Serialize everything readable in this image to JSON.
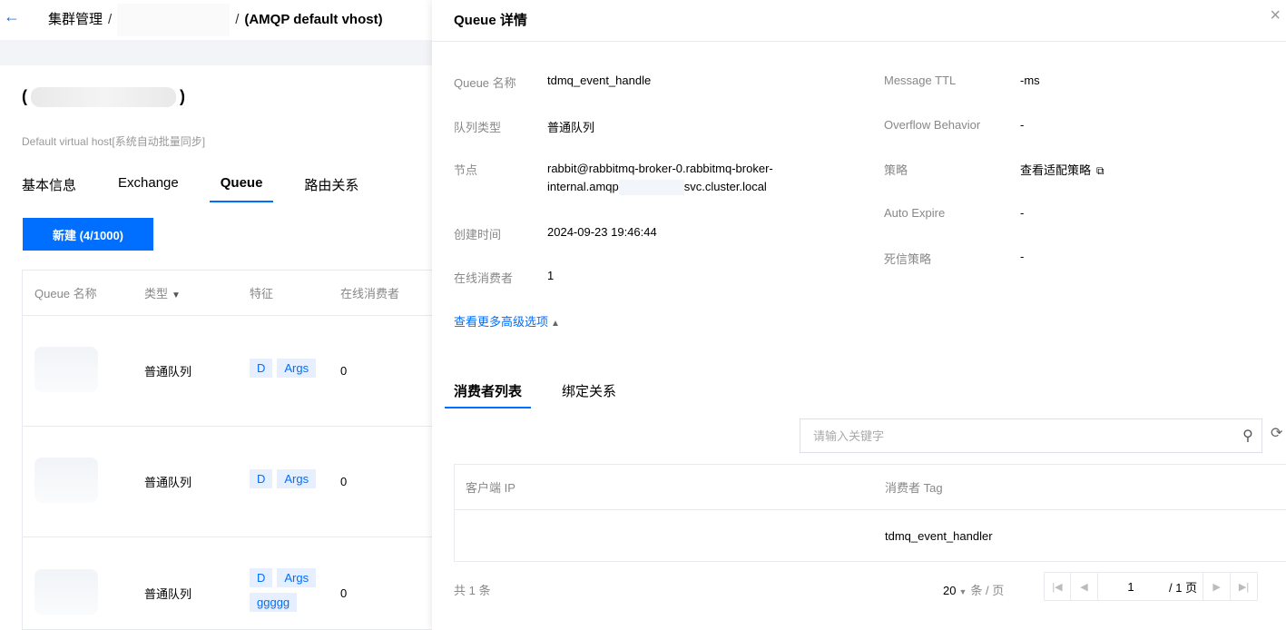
{
  "topbar": {
    "back_icon": "←",
    "crumb_1": "集群管理",
    "sep": "/",
    "crumb_3": "(AMQP default vhost)"
  },
  "left": {
    "cluster_suffix": ")",
    "cluster_prefix": "(",
    "vhost_desc": "Default virtual host[系统自动批量同步]",
    "tabs": [
      "基本信息",
      "Exchange",
      "Queue",
      "路由关系"
    ],
    "new_button": "新建 (4/1000)",
    "table": {
      "headers": [
        "Queue 名称",
        "类型",
        "特征",
        "在线消费者"
      ],
      "rows": [
        {
          "type": "普通队列",
          "tags": [
            "D",
            "Args"
          ],
          "consumers": "0"
        },
        {
          "type": "普通队列",
          "tags": [
            "D",
            "Args"
          ],
          "consumers": "0"
        },
        {
          "type": "普通队列",
          "tags": [
            "D",
            "Args",
            "ggggg"
          ],
          "consumers": "0"
        }
      ]
    }
  },
  "drawer": {
    "title": "Queue 详情",
    "close_icon": "×",
    "fields": {
      "queue_name_label": "Queue 名称",
      "queue_name": "tdmq_event_handle",
      "queue_type_label": "队列类型",
      "queue_type": "普通队列",
      "node_label": "节点",
      "node_line1": "rabbit@rabbitmq-broker-0.rabbitmq-broker-",
      "node_line2a": "internal.amqp",
      "node_line2b": "svc.cluster.local",
      "created_label": "创建时间",
      "created": "2024-09-23 19:46:44",
      "consumers_label": "在线消费者",
      "consumers": "1",
      "ttl_label": "Message TTL",
      "ttl": "-ms",
      "overflow_label": "Overflow Behavior",
      "overflow": "-",
      "policy_label": "策略",
      "policy_link": "查看适配策略",
      "auto_expire_label": "Auto Expire",
      "auto_expire": "-",
      "dlx_label": "死信策略",
      "dlx": "-"
    },
    "more_link": "查看更多高级选项",
    "subtabs": [
      "消费者列表",
      "绑定关系"
    ],
    "search": {
      "placeholder": "请输入关键字"
    },
    "consumer_table": {
      "headers": [
        "客户端 IP",
        "消费者 Tag"
      ],
      "rows": [
        {
          "ip": "",
          "tag": "tdmq_event_handler"
        }
      ]
    },
    "pager": {
      "total": "共 1 条",
      "page_size": "20",
      "unit": "条 / 页",
      "page": "1",
      "total_pages": "/ 1 页"
    }
  }
}
